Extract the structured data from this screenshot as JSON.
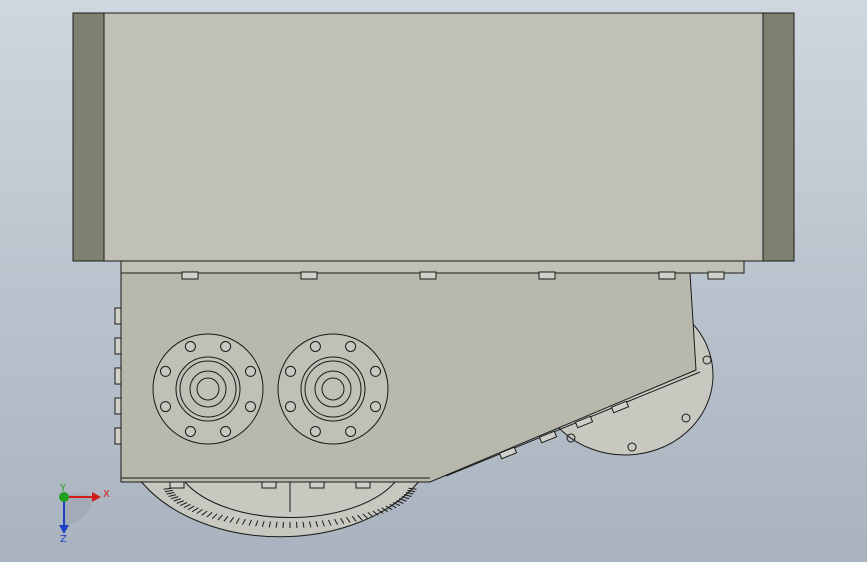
{
  "app": {
    "viewport_name": "cad-graphics-area",
    "background_top": "#cfd6de",
    "background_bottom": "#a9b3bf"
  },
  "model": {
    "body_color": "#c0c0b7",
    "end_cap_color": "#7e8070",
    "plate_color": "#b8b8ad",
    "edge_color": "#1a1a1a"
  },
  "triad": {
    "x_label": "X",
    "y_label": "Y",
    "z_label": "Z",
    "x_color": "#d11c1c",
    "y_color": "#20a020",
    "z_color": "#1d3fc9"
  }
}
